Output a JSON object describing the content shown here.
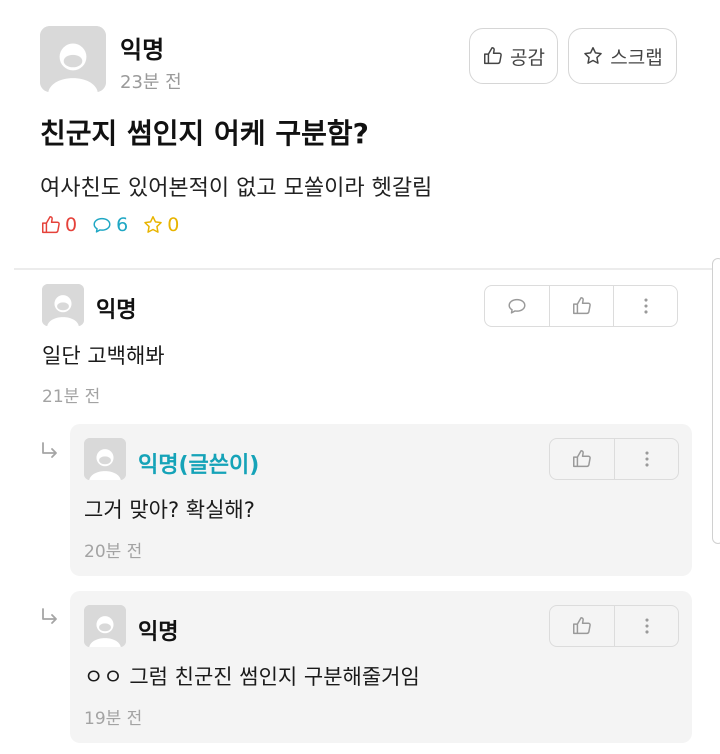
{
  "post": {
    "author": "익명",
    "time": "23분 전",
    "title": "친군지 썸인지 어케 구분함?",
    "body": "여사친도 있어본적이 없고 모쏠이라 헷갈림",
    "buttons": {
      "like_label": "공감",
      "scrap_label": "스크랩"
    },
    "stats": {
      "likes": "0",
      "comments": "6",
      "scraps": "0"
    },
    "colors": {
      "like": "#e5413a",
      "comment": "#1fa7c4",
      "scrap": "#e8b400"
    }
  },
  "comments": [
    {
      "author": "익명",
      "text": "일단 고백해봐",
      "time": "21분 전"
    }
  ],
  "replies": [
    {
      "author": "익명(글쓴이)",
      "text": "그거 맞아? 확실해?",
      "time": "20분 전",
      "is_op": true
    },
    {
      "author": "익명",
      "text": "ㅇㅇ 그럼 친군진 썸인지 구분해줄거임",
      "time": "19분 전",
      "is_op": false
    }
  ],
  "icons": [
    "avatar-icon",
    "thumbs-up-icon",
    "star-icon",
    "speech-bubble-icon",
    "more-vertical-icon",
    "reply-arrow-icon"
  ]
}
